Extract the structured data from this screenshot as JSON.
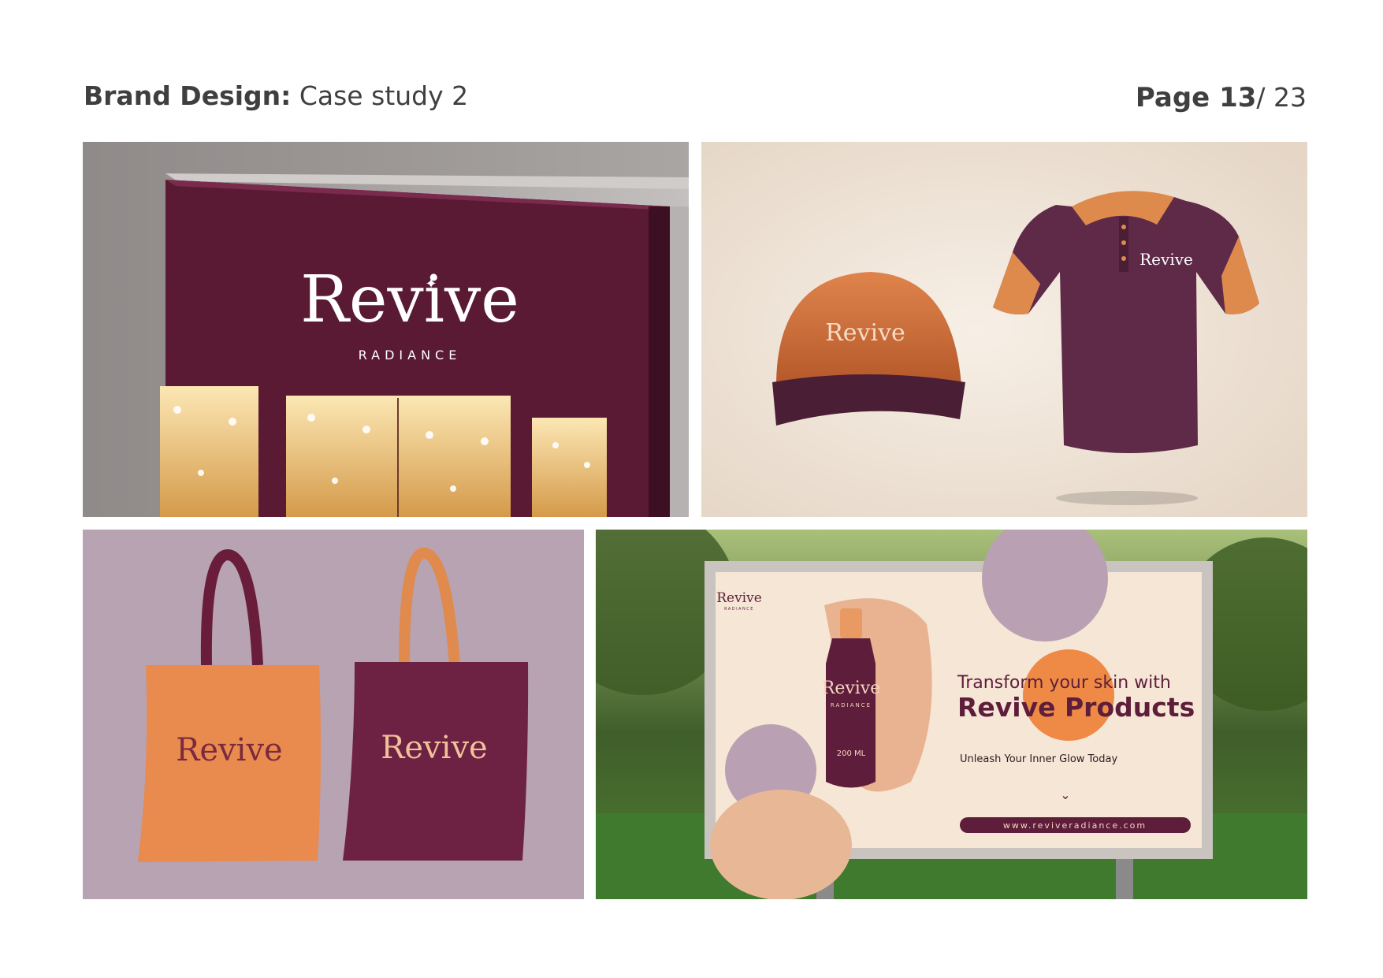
{
  "header": {
    "section_bold": "Brand Design:",
    "section_light": " Case study 2",
    "page_bold": "Page 13",
    "page_light": "/ 23"
  },
  "brand": {
    "wordmark": "Revive",
    "tagline": "RADIANCE",
    "colors": {
      "plum": "#5e1d3a",
      "orange": "#e98a4e",
      "mauve": "#b7a3b1",
      "cream": "#f3e6d8"
    }
  },
  "billboard": {
    "headline_line1": "Transform your skin with",
    "headline_line2": "Revive Products",
    "subline": "Unleash Your Inner Glow Today",
    "url": "www.reviveradiance.com",
    "bottle_volume": "200 ML"
  }
}
